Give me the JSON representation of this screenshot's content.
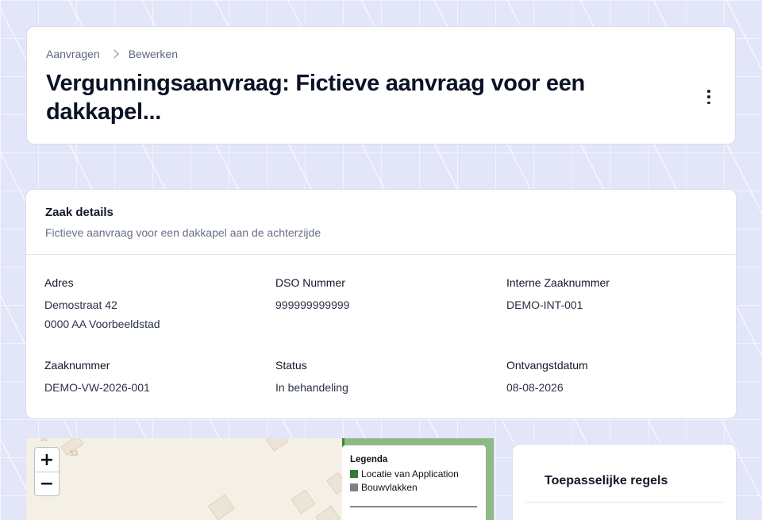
{
  "breadcrumb": {
    "items": [
      "Aanvragen",
      "Bewerken"
    ]
  },
  "header": {
    "title": "Vergunningsaanvraag: Fictieve aanvraag voor een dakkapel..."
  },
  "details": {
    "title": "Zaak details",
    "subtitle": "Fictieve aanvraag voor een dakkapel aan de achterzijde",
    "fields": {
      "adres": {
        "label": "Adres",
        "line1": "Demostraat 42",
        "line2": "0000 AA Voorbeeldstad"
      },
      "dso": {
        "label": "DSO Nummer",
        "value": "999999999999"
      },
      "interne": {
        "label": "Interne Zaaknummer",
        "value": "DEMO-INT-001"
      },
      "zaaknummer": {
        "label": "Zaaknummer",
        "value": "DEMO-VW-2026-001"
      },
      "status": {
        "label": "Status",
        "value": "In behandeling"
      },
      "ontvangst": {
        "label": "Ontvangstdatum",
        "value": "08-08-2026"
      }
    }
  },
  "map": {
    "zoom_in": "+",
    "zoom_out": "−",
    "house_number": "53",
    "house_number_top": "51",
    "legend": {
      "title": "Legenda",
      "items": [
        {
          "label": "Locatie van Application",
          "color": "#2f7d32"
        },
        {
          "label": "Bouwvlakken",
          "color": "#808080"
        }
      ]
    }
  },
  "rules": {
    "title": "Toepasselijke regels"
  },
  "colors": {
    "background": "#e2e6f8",
    "card": "#ffffff",
    "title": "#0b1226"
  }
}
